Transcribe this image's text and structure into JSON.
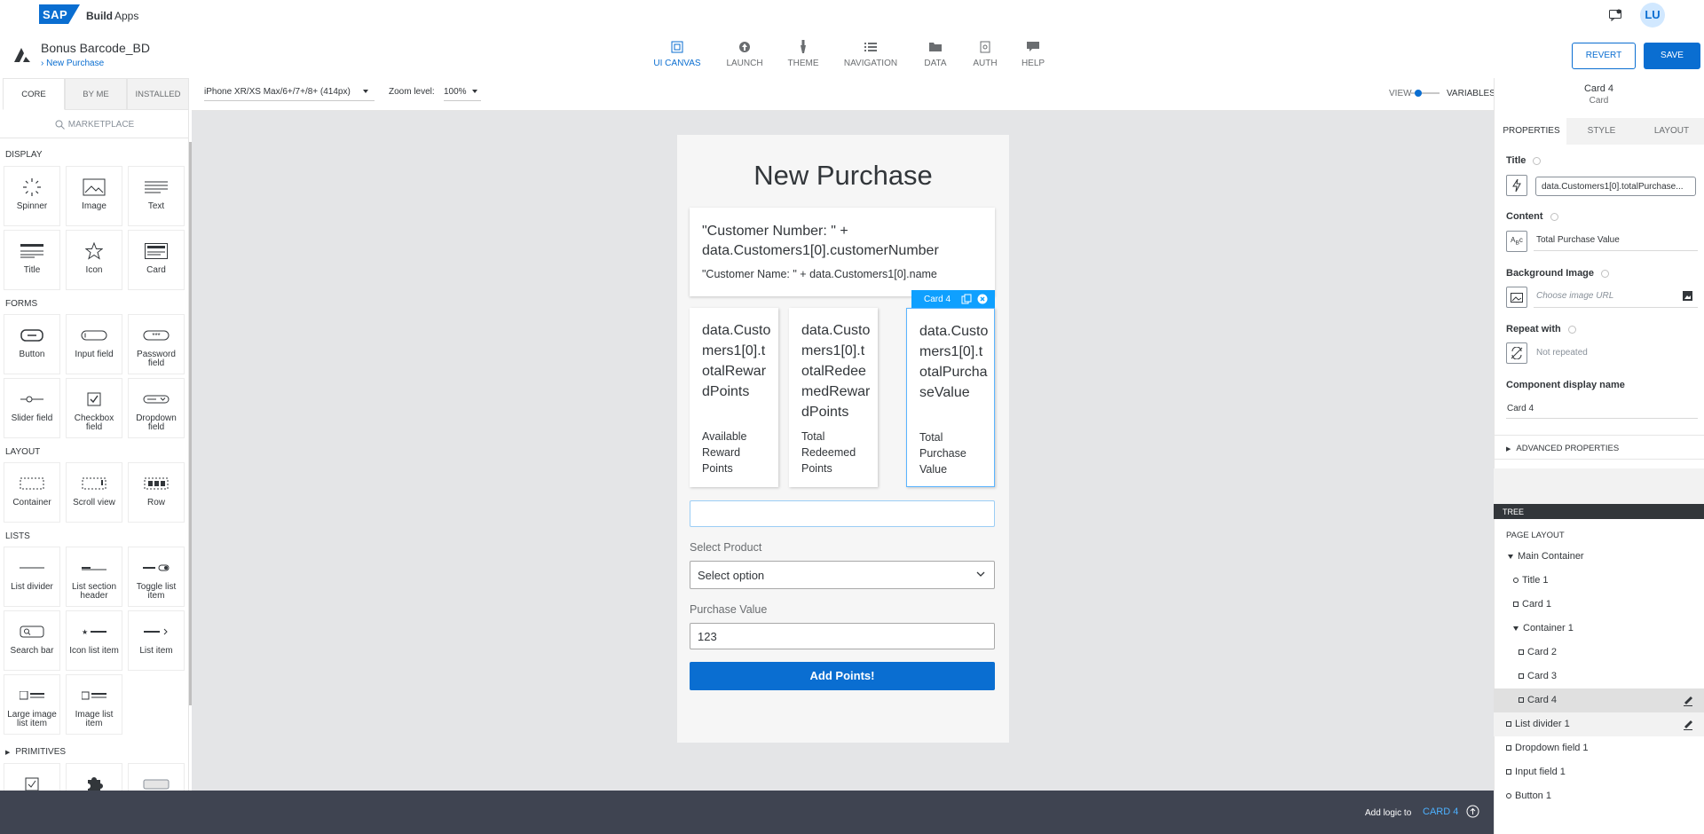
{
  "topbar": {
    "logo": "SAP",
    "product": "Build",
    "section": "Apps",
    "avatar_initials": "LU"
  },
  "app": {
    "project_title": "Bonus Barcode_BD",
    "page_name": "New Purchase"
  },
  "nav_tabs": [
    {
      "label": "UI CANVAS",
      "icon": "canvas-icon",
      "active": true
    },
    {
      "label": "LAUNCH",
      "icon": "launch-icon",
      "active": false
    },
    {
      "label": "THEME",
      "icon": "brush-icon",
      "active": false
    },
    {
      "label": "NAVIGATION",
      "icon": "list-icon",
      "active": false
    },
    {
      "label": "DATA",
      "icon": "folder-icon",
      "active": false
    },
    {
      "label": "AUTH",
      "icon": "lock-icon",
      "active": false
    },
    {
      "label": "HELP",
      "icon": "chat-icon",
      "active": false
    }
  ],
  "actions": {
    "revert": "REVERT",
    "save": "SAVE"
  },
  "left_panel": {
    "tabs": [
      "CORE",
      "BY ME",
      "INSTALLED"
    ],
    "marketplace": "MARKETPLACE",
    "sections": {
      "display": "DISPLAY",
      "forms": "FORMS",
      "layout": "LAYOUT",
      "lists": "LISTS",
      "primitives": "PRIMITIVES"
    },
    "display": [
      "Spinner",
      "Image",
      "Text",
      "Title",
      "Icon",
      "Card"
    ],
    "forms": [
      "Button",
      "Input field",
      "Password field",
      "Slider field",
      "Checkbox field",
      "Dropdown field"
    ],
    "layout": [
      "Container",
      "Scroll view",
      "Row"
    ],
    "lists": [
      "List divider",
      "List section header",
      "Toggle list item",
      "Search bar",
      "Icon list item",
      "List item",
      "Large image list item",
      "Image list item"
    ]
  },
  "toolbar": {
    "device": "iPhone XR/XS Max/6+/7+/8+ (414px)",
    "zoom_label": "Zoom level:",
    "zoom_value": "100%",
    "view_label": "VIEW",
    "variables_label": "VARIABLES"
  },
  "phone": {
    "title": "New Purchase",
    "card1_line1": "\"Customer Number: \" + data.Customers1[0].customerNumber",
    "card1_line2": "\"Customer Name: \" + data.Customers1[0].name",
    "cards": [
      {
        "value": "data.Customers1[0].totalRewardPoints",
        "label": "Available Reward Points"
      },
      {
        "value": "data.Customers1[0].totalRedeemedRewardPoints",
        "label": "Total Redeemed Points"
      },
      {
        "value": "data.Customers1[0].totalPurchaseValue",
        "label": "Total Purchase Value"
      }
    ],
    "selected_badge": "Card 4",
    "select_label": "Select Product",
    "select_value": "Select option",
    "purchase_label": "Purchase Value",
    "purchase_value": "123",
    "button_label": "Add Points!"
  },
  "properties": {
    "selected_name": "Card 4",
    "selected_type": "Card",
    "tabs": [
      "PROPERTIES",
      "STYLE",
      "LAYOUT"
    ],
    "title_label": "Title",
    "title_value": "data.Customers1[0].totalPurchase...",
    "content_label": "Content",
    "content_value": "Total Purchase Value",
    "bg_label": "Background Image",
    "bg_placeholder": "Choose image URL",
    "repeat_label": "Repeat with",
    "repeat_value": "Not repeated",
    "display_name_label": "Component display name",
    "display_name_value": "Card 4",
    "advanced": "ADVANCED PROPERTIES"
  },
  "tree": {
    "header": "TREE",
    "subheader": "PAGE LAYOUT",
    "items": [
      "Main Container",
      "Title 1",
      "Card 1",
      "Container 1",
      "Card 2",
      "Card 3",
      "Card 4",
      "List divider 1",
      "Dropdown field 1",
      "Input field 1",
      "Button 1"
    ]
  },
  "bottombar": {
    "logic_label": "Add logic to",
    "logic_target": "CARD 4"
  },
  "colors": {
    "accent": "#0a6ed1",
    "selection": "#0fa0ff",
    "bottombar": "#3f4451",
    "canvas": "#e4e5e7"
  }
}
